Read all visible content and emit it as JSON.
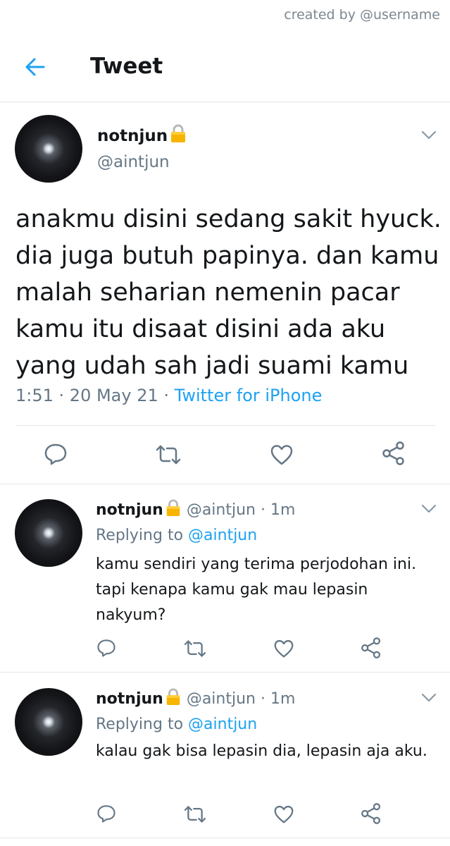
{
  "credit": "created by @username",
  "header": {
    "title": "Tweet",
    "back_icon": "arrow-left-icon",
    "accent": "#1da1f2"
  },
  "main_tweet": {
    "name": "notnjun",
    "handle": "@aintjun",
    "text": "anakmu disini sedang sakit hyuck. dia juga butuh papinya. dan kamu malah seharian nemenin pacar kamu itu disaat disini ada aku yang udah sah jadi suami kamu",
    "time": "1:51",
    "date": "20 May 21",
    "source": "Twitter for iPhone",
    "separator": " · "
  },
  "replies": [
    {
      "name": "notnjun",
      "handle_time": "@aintjun · 1m",
      "replying_label": "Replying to",
      "replying_to": "@aintjun",
      "text": "kamu sendiri yang terima perjodohan ini. tapi kenapa kamu gak mau lepasin nakyum?"
    },
    {
      "name": "notnjun",
      "handle_time": "@aintjun · 1m",
      "replying_label": "Replying to",
      "replying_to": "@aintjun",
      "text": "kalau gak bisa lepasin dia, lepasin aja aku."
    }
  ],
  "icons": [
    "reply-icon",
    "retweet-icon",
    "like-icon",
    "share-icon",
    "lock-icon",
    "chevron-down-icon"
  ]
}
